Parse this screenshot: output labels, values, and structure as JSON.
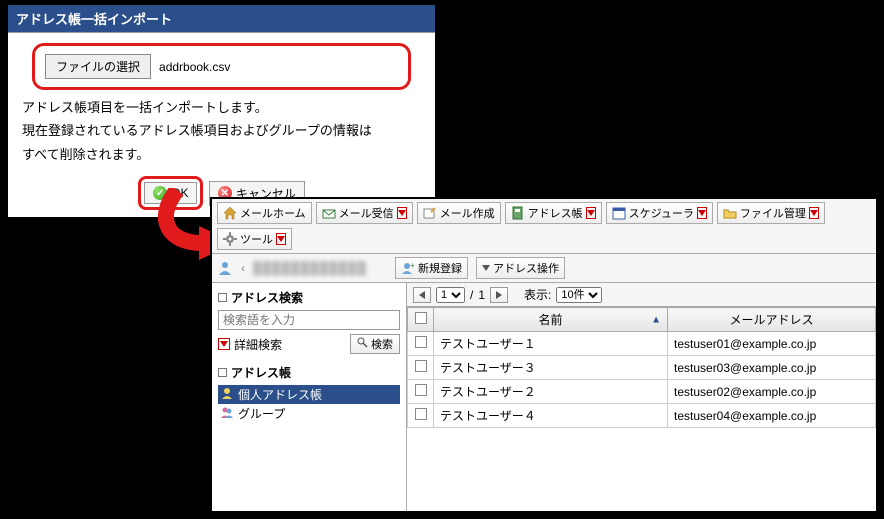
{
  "dialog": {
    "title": "アドレス帳一括インポート",
    "file_button": "ファイルの選択",
    "file_name": "addrbook.csv",
    "body_line1": "アドレス帳項目を一括インポートします。",
    "body_line2": "現在登録されているアドレス帳項目およびグループの情報は",
    "body_line3": "すべて削除されます。",
    "ok": "OK",
    "cancel": "キャンセル"
  },
  "toolbar": {
    "mail_home": "メールホーム",
    "mail_recv": "メール受信",
    "mail_compose": "メール作成",
    "address": "アドレス帳",
    "schedule": "スケジューラ",
    "file_mgmt": "ファイル管理",
    "tools": "ツール"
  },
  "subbar": {
    "path": "（ユーザー / パス表示）",
    "new_reg": "新規登録",
    "addr_ops": "アドレス操作"
  },
  "sidebar": {
    "search_title": "アドレス検索",
    "search_placeholder": "検索語を入力",
    "detail_search": "詳細検索",
    "search_btn": "検索",
    "tree_title": "アドレス帳",
    "personal": "個人アドレス帳",
    "group": "グループ"
  },
  "pager": {
    "page_current": "1",
    "page_total": "1",
    "display_label": "表示:",
    "per_page": "10件"
  },
  "table": {
    "col_name": "名前",
    "col_email": "メールアドレス",
    "rows": [
      {
        "name": "テストユーザー１",
        "email": "testuser01@example.co.jp"
      },
      {
        "name": "テストユーザー３",
        "email": "testuser03@example.co.jp"
      },
      {
        "name": "テストユーザー２",
        "email": "testuser02@example.co.jp"
      },
      {
        "name": "テストユーザー４",
        "email": "testuser04@example.co.jp"
      }
    ]
  }
}
